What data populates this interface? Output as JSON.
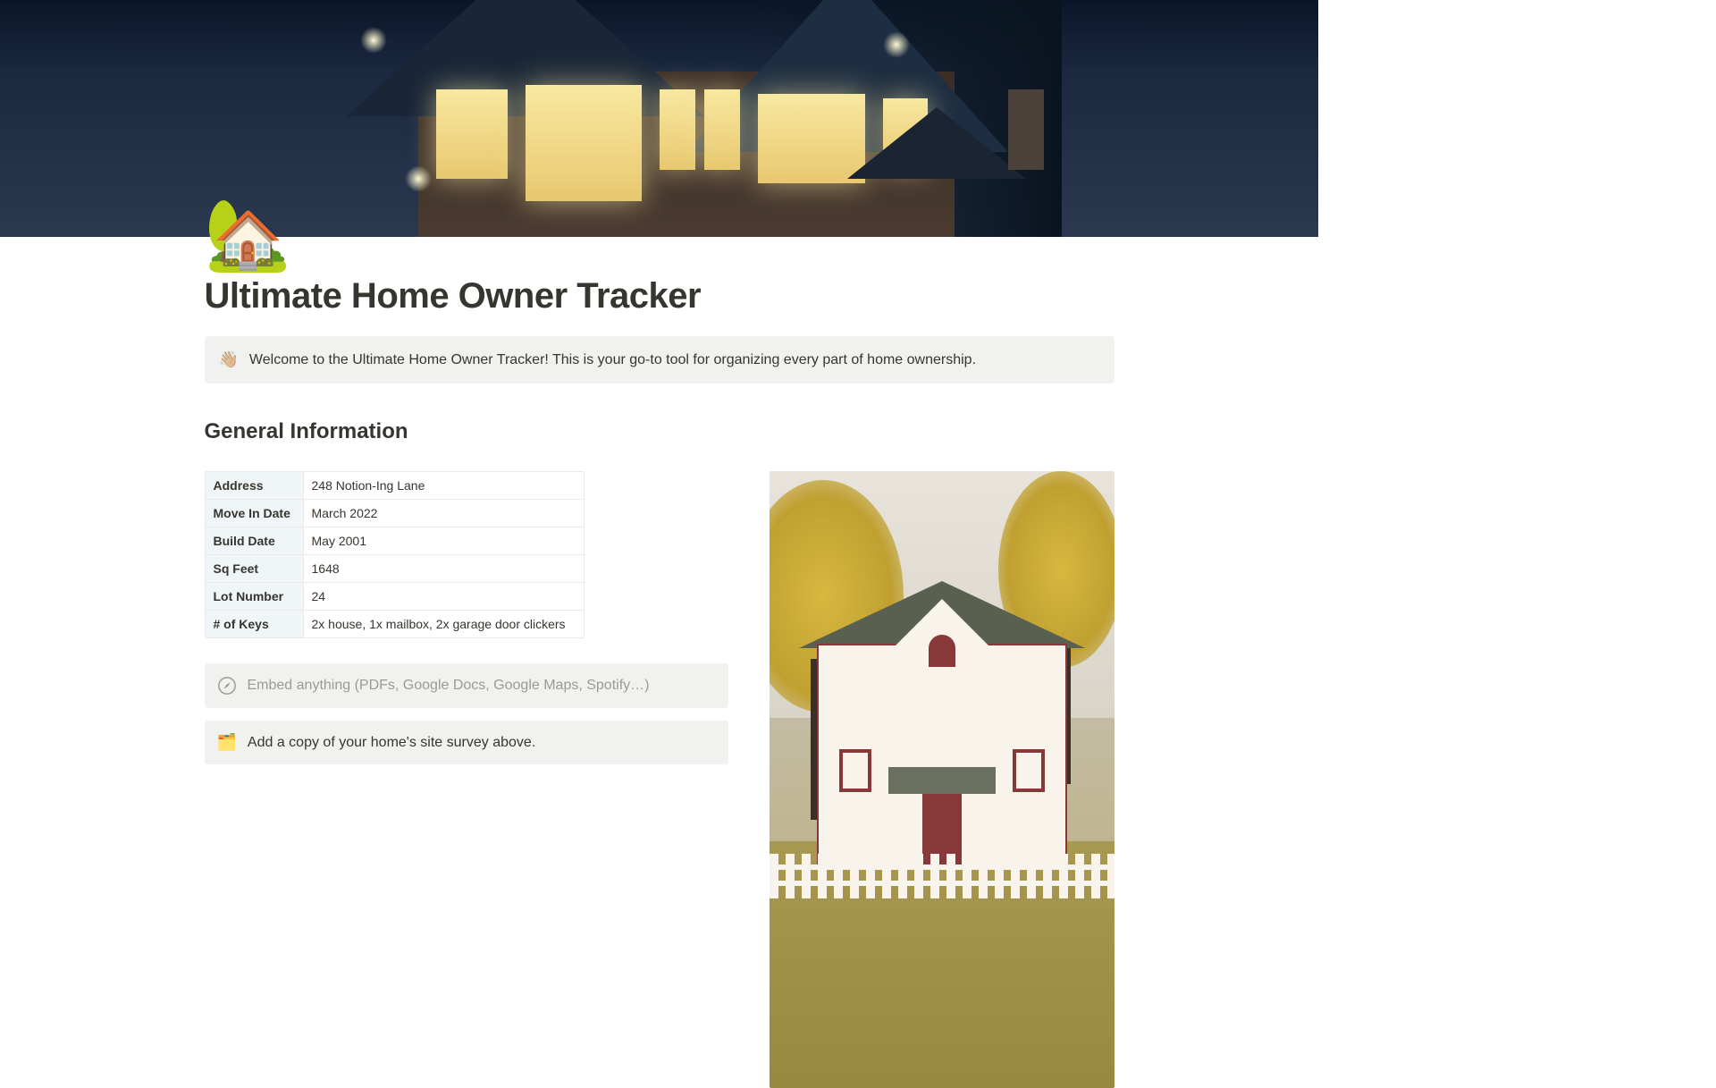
{
  "icon": "🏡",
  "title": "Ultimate Home Owner Tracker",
  "welcome": {
    "emoji": "👋🏼",
    "text": "Welcome to the Ultimate Home Owner Tracker! This is your go-to tool for organizing every part of home ownership."
  },
  "section_general": "General Information",
  "info": [
    {
      "label": "Address",
      "value": "248 Notion-Ing Lane"
    },
    {
      "label": "Move In Date",
      "value": "March 2022"
    },
    {
      "label": "Build Date",
      "value": "May 2001"
    },
    {
      "label": "Sq Feet",
      "value": "1648"
    },
    {
      "label": "Lot Number",
      "value": "24"
    },
    {
      "label": "# of Keys",
      "value": "2x house, 1x mailbox, 2x garage door clickers"
    }
  ],
  "embed_placeholder": "Embed anything (PDFs, Google Docs, Google Maps, Spotify…)",
  "note": {
    "emoji": "🗂️",
    "text": "Add a copy of your home's site survey above."
  }
}
